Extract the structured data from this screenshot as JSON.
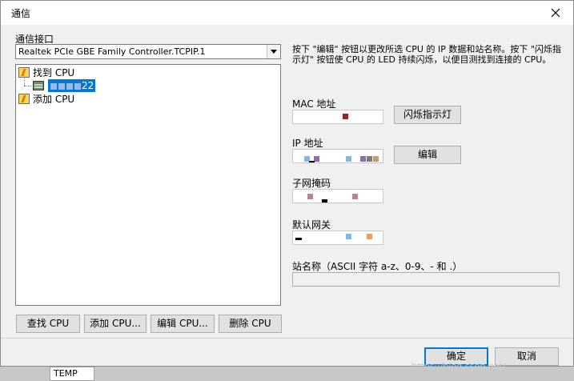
{
  "dialog": {
    "title": "通信",
    "close_label": "✕"
  },
  "interface": {
    "label": "通信接口",
    "selected": "Realtek PCIe GBE Family Controller.TCPIP.1"
  },
  "tree": {
    "found_cpu": "找到 CPU",
    "cpu_item_suffix": "22",
    "add_cpu": "添加 CPU"
  },
  "buttons": {
    "find_cpu": "查找 CPU",
    "add_cpu": "添加 CPU...",
    "edit_cpu": "编辑 CPU...",
    "delete_cpu": "删除 CPU",
    "flash_led": "闪烁指示灯",
    "edit": "编辑",
    "ok": "确定",
    "cancel": "取消"
  },
  "info": {
    "text": "按下 \"编辑\" 按钮以更改所选 CPU 的 IP 数据和站名称。按下 \"闪烁指示灯\" 按钮使 CPU 的 LED 持续闪烁，以便目测找到连接的 CPU。"
  },
  "fields": {
    "mac_label": "MAC 地址",
    "ip_label": "IP 地址",
    "subnet_label": "子网掩码",
    "gateway_label": "默认网关",
    "station_label": "站名称（ASCII 字符 a-z、0-9、- 和 .）"
  },
  "background": {
    "cell_text": "TEMP"
  },
  "watermark": "https://blog.csdn.net/..."
}
